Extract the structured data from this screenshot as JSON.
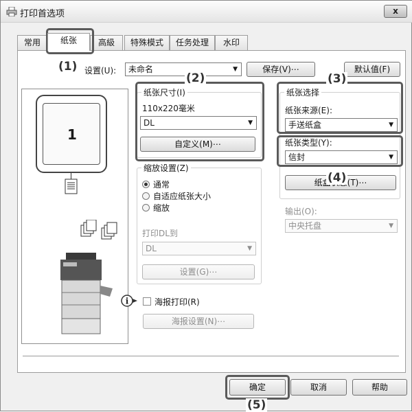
{
  "window": {
    "title": "打印首选项",
    "close_label": "x"
  },
  "tabs": [
    {
      "label": "常用",
      "active": false
    },
    {
      "label": "纸张",
      "active": true
    },
    {
      "label": "高級",
      "active": false
    },
    {
      "label": "特殊模式",
      "active": false
    },
    {
      "label": "任务处理",
      "active": false
    },
    {
      "label": "水印",
      "active": false
    }
  ],
  "settings": {
    "label": "设置(U):",
    "value": "未命名",
    "save_button": "保存(V)⋯",
    "default_button": "默认值(F)"
  },
  "preview": {
    "page_number": "1"
  },
  "paper_size": {
    "title": "纸张尺寸(I)",
    "dimension": "110x220毫米",
    "value": "DL",
    "custom_button": "自定义(M)⋯"
  },
  "zoom": {
    "title": "缩放设置(Z)",
    "options": [
      "通常",
      "自适应纸张大小",
      "缩放"
    ],
    "selected": "通常",
    "print_to_label": "打印DL到",
    "print_to_value": "DL",
    "settings_button": "设置(G)⋯"
  },
  "poster": {
    "label": "海报打印(R)",
    "settings_button": "海报设置(N)⋯"
  },
  "paper_selection": {
    "title": "纸张选择",
    "source_label": "纸张来源(E):",
    "source_value": "手送纸盒",
    "type_label": "纸张类型(Y):",
    "type_value": "信封",
    "tray_button": "纸盒状态(T)⋯"
  },
  "output": {
    "label": "输出(O):",
    "value": "中央托盘"
  },
  "footer": {
    "ok": "确定",
    "cancel": "取消",
    "help": "帮助"
  },
  "callouts": [
    "(1)",
    "(2)",
    "(3)",
    "(4)",
    "(5)"
  ],
  "icons": {
    "window": "printer-icon",
    "info": "info-icon",
    "dropdown": "chevron-down-icon",
    "document": "document-icon",
    "copies": "copies-icon",
    "copier": "copier-machine-icon"
  }
}
